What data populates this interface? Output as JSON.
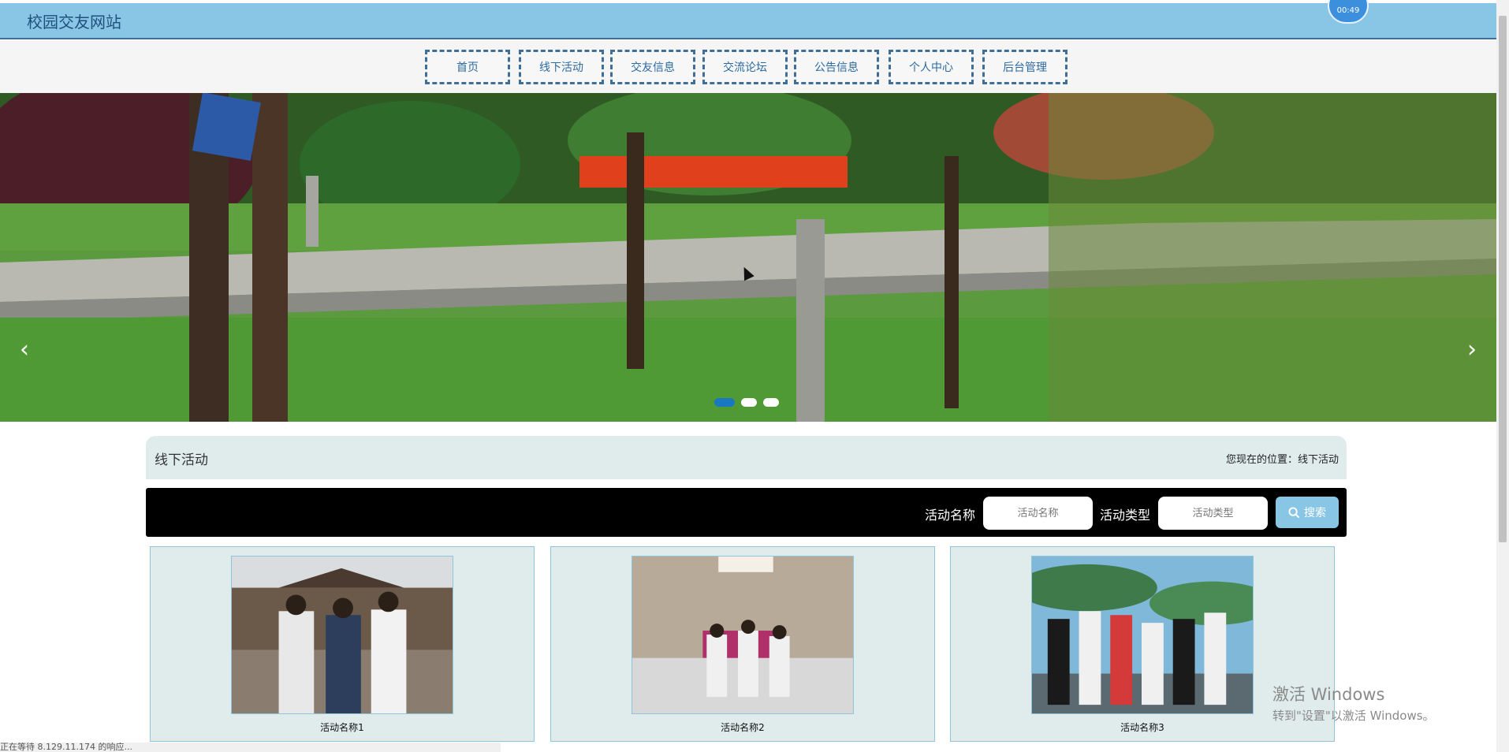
{
  "header": {
    "site_title": "校园交友网站",
    "timer": "00:49"
  },
  "nav": {
    "items": [
      "首页",
      "线下活动",
      "交友信息",
      "交流论坛",
      "公告信息",
      "个人中心",
      "后台管理"
    ]
  },
  "banner": {
    "prev_icon": "chevron-left-icon",
    "next_icon": "chevron-right-icon",
    "slide_count": 3,
    "active_slide": 1
  },
  "section": {
    "title": "线下活动",
    "location": "您现在的位置：线下活动"
  },
  "search": {
    "name_label": "活动名称",
    "name_placeholder": "活动名称",
    "type_label": "活动类型",
    "type_placeholder": "活动类型",
    "button_label": "搜索",
    "button_icon": "search-icon"
  },
  "activities": [
    {
      "name": "活动名称1"
    },
    {
      "name": "活动名称2"
    },
    {
      "name": "活动名称3"
    }
  ],
  "watermark": {
    "line1": "激活 Windows",
    "line2": "转到\"设置\"以激活 Windows。"
  },
  "status": {
    "text": "正在等待 8.129.11.174 的响应..."
  },
  "colors": {
    "header_bg": "#89c6e6",
    "accent": "#1a78c2",
    "search_bg": "#000000",
    "card_bg": "#dfeceb"
  }
}
